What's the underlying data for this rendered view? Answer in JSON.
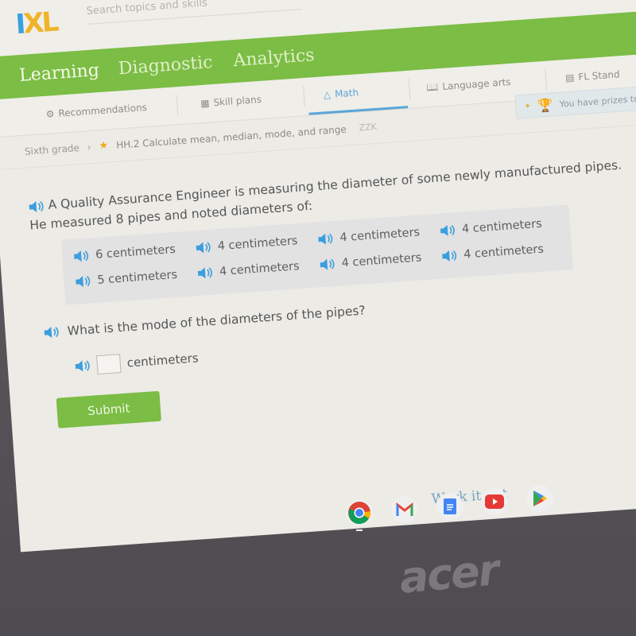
{
  "app": {
    "logo": {
      "i": "I",
      "xl": "XL"
    },
    "search_placeholder": "Search topics and skills"
  },
  "main_nav": {
    "tabs": [
      {
        "label": "Learning",
        "active": true
      },
      {
        "label": "Diagnostic",
        "active": false
      },
      {
        "label": "Analytics",
        "active": false
      }
    ]
  },
  "sub_nav": {
    "items": [
      {
        "label": "Recommendations",
        "icon": "recommendations-icon"
      },
      {
        "label": "Skill plans",
        "icon": "skill-plans-icon"
      },
      {
        "label": "Math",
        "icon": "math-icon",
        "active": true
      },
      {
        "label": "Language arts",
        "icon": "book-icon"
      },
      {
        "label": "FL Stand",
        "icon": "standards-icon"
      }
    ],
    "prize_text": "You have prizes to"
  },
  "breadcrumb": {
    "grade": "Sixth grade",
    "skill": "HH.2 Calculate mean, median, mode, and range",
    "code": "ZZK"
  },
  "question": {
    "intro": "A Quality Assurance Engineer is measuring the diameter of some newly manufactured pipes. He measured 8 pipes and noted diameters of:",
    "values": [
      "6 centimeters",
      "4 centimeters",
      "4 centimeters",
      "4 centimeters",
      "5 centimeters",
      "4 centimeters",
      "4 centimeters",
      "4 centimeters"
    ],
    "prompt": "What is the mode of the diameters of the pipes?",
    "answer_value": "",
    "unit": "centimeters",
    "submit_label": "Submit",
    "work_it_out": "Work it out"
  },
  "shelf": {
    "apps": [
      "Chrome",
      "Gmail",
      "Docs",
      "YouTube",
      "Play Store"
    ]
  },
  "device": {
    "brand": "acer"
  },
  "colors": {
    "ixl_green": "#7cbd45",
    "ixl_blue": "#3aa0e0",
    "ixl_yellow": "#f0b429",
    "math_blue": "#5aa6d8"
  }
}
